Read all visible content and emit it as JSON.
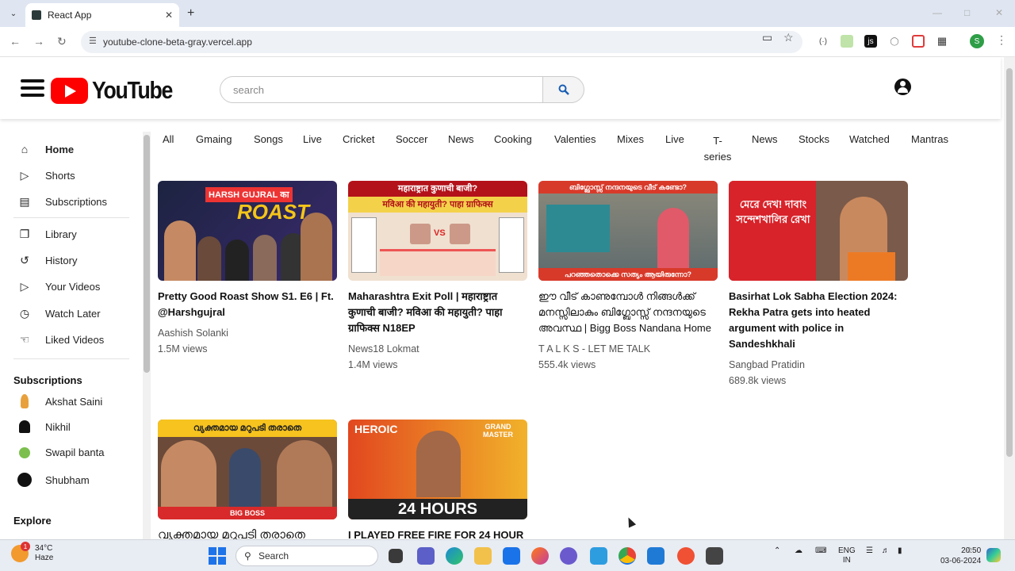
{
  "browser": {
    "tab_title": "React App",
    "url": "youtube-clone-beta-gray.vercel.app",
    "profile_initial": "S"
  },
  "header": {
    "logo_text": "YouTube",
    "search_placeholder": "search",
    "search_icon": "search-icon",
    "account_icon": "user-circle-icon"
  },
  "sidebar": {
    "main": [
      {
        "label": "Home",
        "icon": "home-icon"
      },
      {
        "label": "Shorts",
        "icon": "shorts-icon"
      },
      {
        "label": "Subscriptions",
        "icon": "subscriptions-icon"
      }
    ],
    "library": [
      {
        "label": "Library",
        "icon": "library-icon"
      },
      {
        "label": "History",
        "icon": "history-icon"
      },
      {
        "label": "Your Videos",
        "icon": "your-videos-icon"
      },
      {
        "label": "Watch Later",
        "icon": "watch-later-icon"
      },
      {
        "label": "Liked Videos",
        "icon": "liked-icon"
      }
    ],
    "subscriptions_heading": "Subscriptions",
    "subscriptions": [
      {
        "name": "Akshat Saini",
        "color": "#e8a03c"
      },
      {
        "name": "Nikhil",
        "color": "#111111"
      },
      {
        "name": "Swapil banta",
        "color": "#7cbf4e"
      },
      {
        "name": "Shubham",
        "color": "#111111"
      }
    ],
    "explore_heading": "Explore"
  },
  "chips": [
    "All",
    "Gmaing",
    "Songs",
    "Live",
    "Cricket",
    "Soccer",
    "News",
    "Cooking",
    "Valenties",
    "Mixes",
    "Live",
    "T-series",
    "News",
    "Stocks",
    "Watched",
    "Mantras"
  ],
  "videos": [
    {
      "title": "Pretty Good Roast Show S1. E6 | Ft. @Harshgujral",
      "channel": "Aashish Solanki",
      "views": "1.5M views",
      "thumb_text": "HARSH GUJRAL का ROAST",
      "thumb_colors": [
        "#1c2340",
        "#3a2a6e"
      ]
    },
    {
      "title": "Maharashtra Exit Poll | महाराष्ट्रात कुणाची बाजी? मविआ की महायुती? पाहा ग्राफिक्स N18EP",
      "channel": "News18 Lokmat",
      "views": "1.4M views",
      "thumb_text": "महाराष्ट्रात कुणाची बाजी? मविआ की महायुती? पाहा ग्राफिक्स",
      "thumb_colors": [
        "#b3121a",
        "#f3d24a"
      ]
    },
    {
      "title": "ഈ വീട് കാണുമ്പോൾ നിങ്ങൾക്ക് മനസ്സിലാകും ബിഗ്ബോസ്സ് നന്ദനയുടെ അവസ്ഥ | Bigg Boss Nandana Home",
      "channel": "T A L K S - LET ME TALK",
      "views": "555.4k views",
      "thumb_text": "ബിഗ്ബോസ്സ് നന്ദനയുടെ വീട് കണ്ടോ? പറഞ്ഞതൊക്കെ സത്യം ആയിരുന്നോ?",
      "thumb_colors": [
        "#6b6b62",
        "#2d8a93"
      ]
    },
    {
      "title": "Basirhat Lok Sabha Election 2024: Rekha Patra gets into heated argument with police in Sandeshkhali",
      "channel": "Sangbad Pratidin",
      "views": "689.8k views",
      "thumb_text": "মেরে দেখ! দাবাং সন্দেশখালির রেখা",
      "thumb_colors": [
        "#d8232a",
        "#7a5a4a"
      ]
    },
    {
      "title": "വ്യക്തമായ മറുപടി തരാതെ",
      "channel": "",
      "views": "",
      "thumb_text": "വ്യക്തമായ മറുപടി തരാതെ",
      "thumb_colors": [
        "#f6c31f",
        "#7a4a3a"
      ]
    },
    {
      "title": "I PLAYED FREE FIRE FOR 24 HOUR ||",
      "channel": "",
      "views": "",
      "thumb_text": "HEROIC GRAND MASTER 24 HOURS",
      "thumb_colors": [
        "#e2471f",
        "#f1b22a"
      ]
    }
  ],
  "taskbar": {
    "weather_temp": "34°C",
    "weather_desc": "Haze",
    "notification_count": "1",
    "search_label": "Search",
    "lang_line1": "ENG",
    "lang_line2": "IN",
    "time": "20:50",
    "date": "03-06-2024"
  }
}
